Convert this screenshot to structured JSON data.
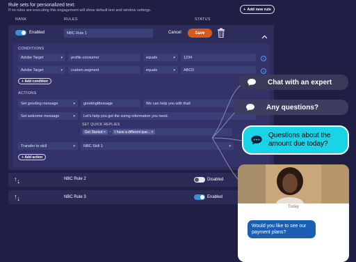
{
  "header": {
    "title": "Rule sets for personalized text:",
    "subtitle": "If no rules are executing this engagement will show default text and window settings.",
    "add_rule_label": "Add new rule"
  },
  "columns": {
    "rank": "RANK",
    "rules": "RULES",
    "status": "STATUS"
  },
  "rule1": {
    "enabled_label": "Enabled",
    "name": "NBC Rule 1",
    "cancel_label": "Cancel",
    "save_label": "Save",
    "conditions_title": "CONDITIONS",
    "conditions": [
      {
        "source": "Adobe Target",
        "attribute": "profile.consumer",
        "operator": "equals",
        "value": "1234"
      },
      {
        "source": "Adobe Target",
        "attribute": "custom.segment",
        "operator": "equals",
        "value": "ABCD"
      }
    ],
    "add_condition_label": "Add condition",
    "actions_title": "ACTIONS",
    "actions": [
      {
        "type": "Set greeting message",
        "key": "greetingMessage",
        "value": "We can help you with that!"
      },
      {
        "type": "Set welcome message",
        "value": "Let's help you get the sizing information you need."
      }
    ],
    "quick_replies_title": "SET QUICK REPLIES",
    "quick_replies": [
      "Get Started",
      "I have a different que..."
    ],
    "transfer": {
      "type": "Transfer to skill",
      "skill": "NBC Skill 1"
    },
    "add_action_label": "Add action"
  },
  "rules": [
    {
      "name": "NBC Rule 2",
      "status": "Disabled"
    },
    {
      "name": "NBC Rule 3",
      "status": "Enabled"
    }
  ],
  "bubbles": [
    {
      "text": "Chat with an expert"
    },
    {
      "text": "Any questions?"
    },
    {
      "text": "Questions about the amount due today?"
    }
  ],
  "chat": {
    "day_label": "Today",
    "message": "Would you like to see our payment plans?"
  },
  "colors": {
    "accent": "#3a8fd6",
    "save": "#d65a1f",
    "highlight_bubble": "#19d4e6"
  }
}
